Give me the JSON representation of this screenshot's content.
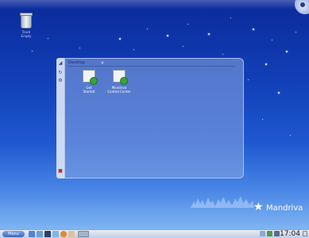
{
  "desktop": {
    "trash_label": "Trash\nEmpty"
  },
  "folder_view": {
    "title": "Desktop",
    "items": [
      {
        "label": "Get\nStarted",
        "badge_color": "#3aa53a"
      },
      {
        "label": "Mandriva\nControl Center",
        "badge_color": "#3aa53a"
      }
    ]
  },
  "branding": {
    "logo_text": "Mandriva"
  },
  "taskbar": {
    "menu_label": "Menu",
    "clock": "17:04"
  },
  "colors": {
    "sky_top": "#0a2a9a",
    "sky_bottom": "#8cc0f4",
    "taskbar": "#dfe6f4"
  }
}
